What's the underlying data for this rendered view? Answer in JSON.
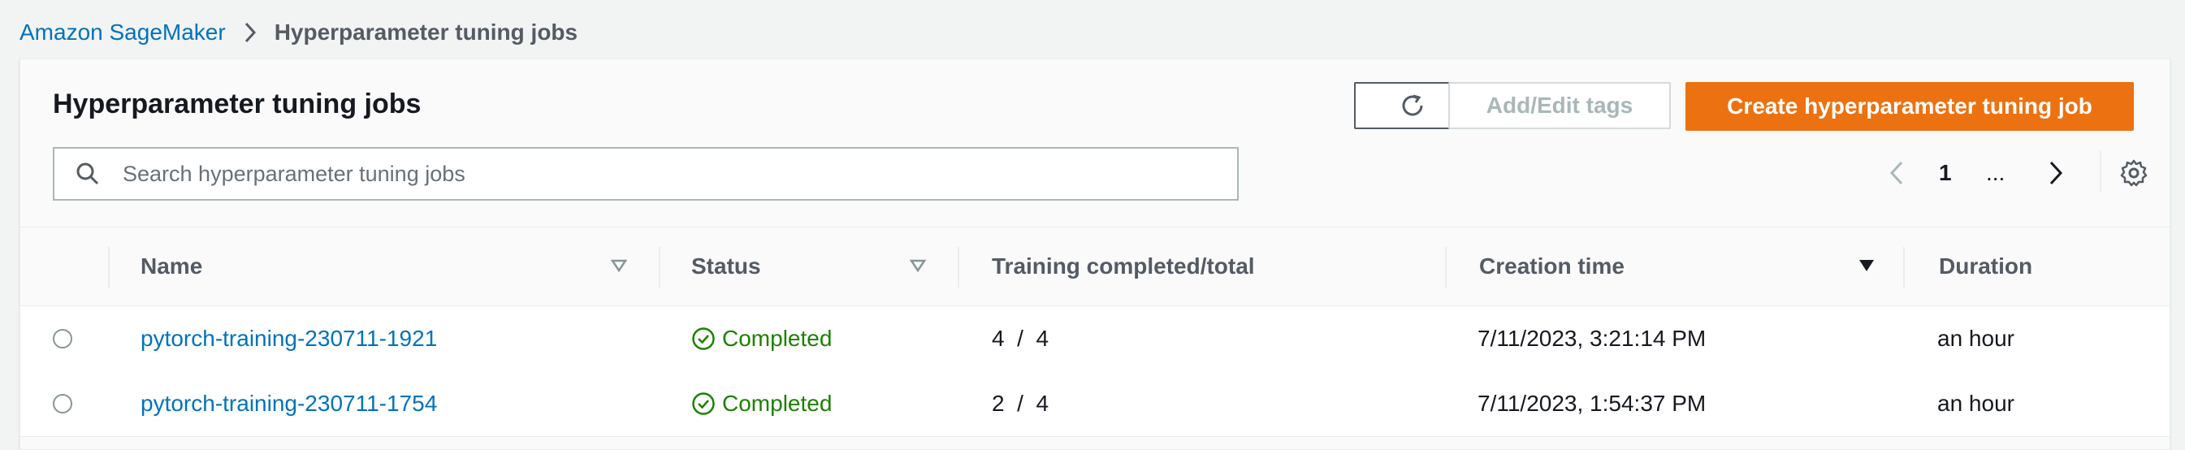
{
  "breadcrumb": {
    "parent": "Amazon SageMaker",
    "current": "Hyperparameter tuning jobs"
  },
  "panel": {
    "title": "Hyperparameter tuning jobs",
    "add_edit_tags_label": "Add/Edit tags",
    "create_label": "Create hyperparameter tuning job",
    "refresh_icon": "refresh-icon"
  },
  "search": {
    "placeholder": "Search hyperparameter tuning jobs",
    "value": ""
  },
  "pagination": {
    "current_page": "1",
    "ellipsis": "...",
    "prev_icon": "chevron-left-icon",
    "next_icon": "chevron-right-icon",
    "settings_icon": "gear-icon"
  },
  "table": {
    "columns": [
      {
        "label": "Name",
        "sort": "unsorted"
      },
      {
        "label": "Status",
        "sort": "unsorted"
      },
      {
        "label": "Training completed/total",
        "sort": "none"
      },
      {
        "label": "Creation time",
        "sort": "descending"
      },
      {
        "label": "Duration",
        "sort": "none"
      }
    ],
    "rows": [
      {
        "name": "pytorch-training-230711-1921",
        "status": "Completed",
        "training": "4  /  4",
        "creation_time": "7/11/2023, 3:21:14 PM",
        "duration": "an hour"
      },
      {
        "name": "pytorch-training-230711-1754",
        "status": "Completed",
        "training": "2  /  4",
        "creation_time": "7/11/2023, 1:54:37 PM",
        "duration": "an hour"
      }
    ]
  },
  "colors": {
    "link": "#0073bb",
    "primary_button": "#ec7211",
    "success": "#1d8102",
    "header_text": "#545b64"
  }
}
